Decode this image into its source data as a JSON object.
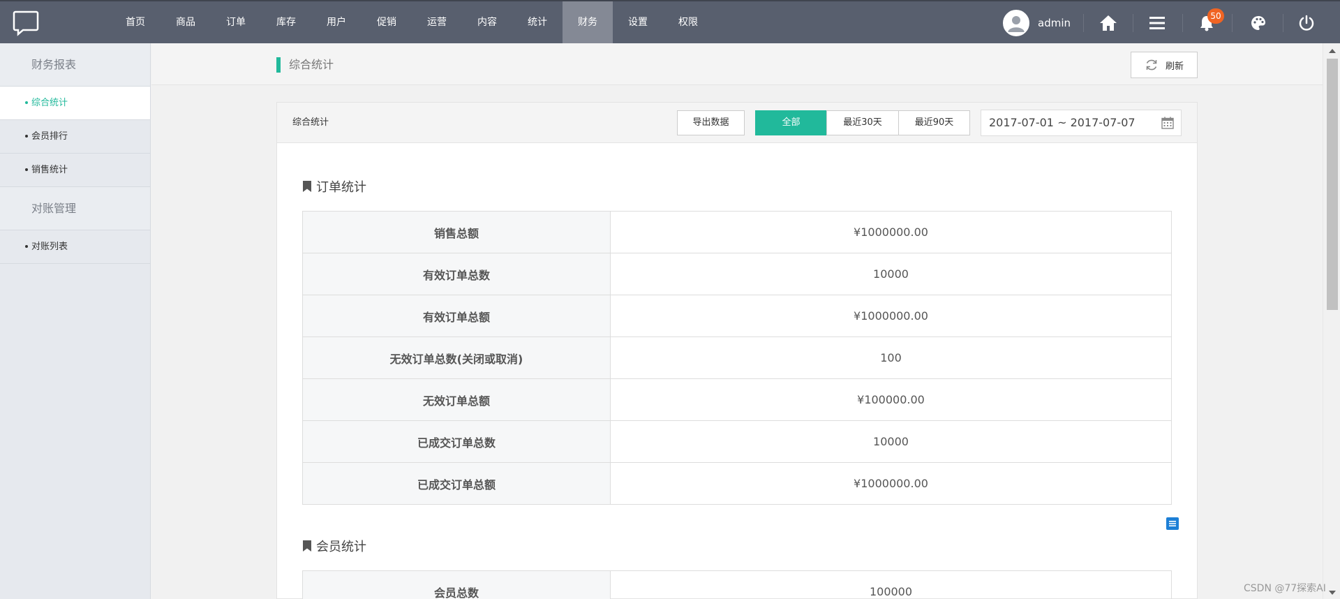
{
  "nav": [
    "首页",
    "商品",
    "订单",
    "库存",
    "用户",
    "促销",
    "运营",
    "内容",
    "统计",
    "财务",
    "设置",
    "权限"
  ],
  "nav_active_index": 9,
  "user": {
    "name": "admin"
  },
  "notifications": {
    "count": "50"
  },
  "sidebar": {
    "groups": [
      {
        "title": "财务报表",
        "items": [
          "综合统计",
          "会员排行",
          "销售统计"
        ]
      },
      {
        "title": "对账管理",
        "items": [
          "对账列表"
        ]
      }
    ],
    "active_item": "综合统计"
  },
  "page": {
    "title": "综合统计",
    "refresh_label": "刷新"
  },
  "panel": {
    "title": "综合统计",
    "export_label": "导出数据",
    "range_buttons": [
      "全部",
      "最近30天",
      "最近90天"
    ],
    "active_range": "全部",
    "date_range": "2017-07-01 ~ 2017-07-07"
  },
  "order_stats": {
    "title": "订单统计",
    "rows": [
      {
        "label": "销售总额",
        "value": "¥1000000.00"
      },
      {
        "label": "有效订单总数",
        "value": "10000"
      },
      {
        "label": "有效订单总额",
        "value": "¥1000000.00"
      },
      {
        "label": "无效订单总数(关闭或取消)",
        "value": "100"
      },
      {
        "label": "无效订单总额",
        "value": "¥100000.00"
      },
      {
        "label": "已成交订单总数",
        "value": "10000"
      },
      {
        "label": "已成交订单总额",
        "value": "¥1000000.00"
      }
    ]
  },
  "member_stats": {
    "title": "会员统计",
    "rows": [
      {
        "label": "会员总数",
        "value": "100000"
      }
    ]
  },
  "watermark": "CSDN @77探索AI",
  "colors": {
    "accent": "#21b99b",
    "topbar": "#585f6e",
    "badge": "#f06423"
  }
}
